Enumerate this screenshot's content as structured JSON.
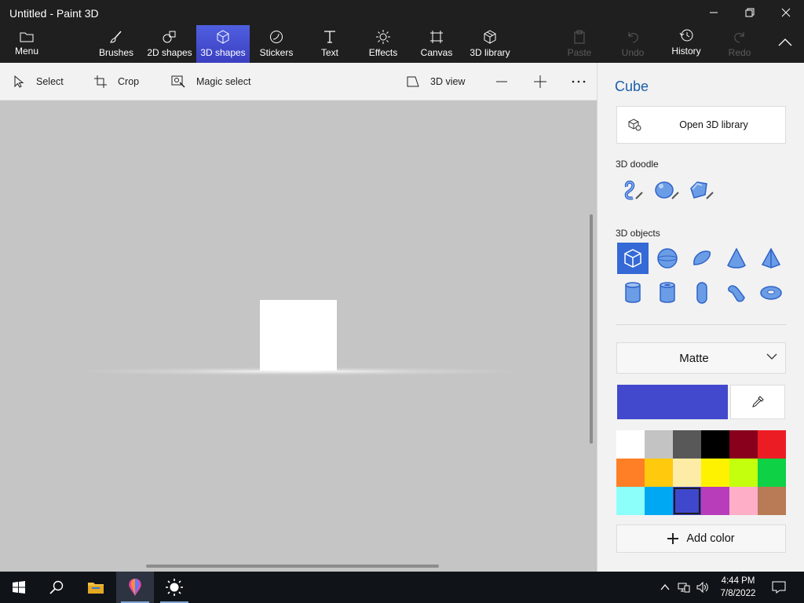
{
  "window": {
    "title": "Untitled - Paint 3D"
  },
  "ribbon": {
    "menu": "Menu",
    "tabs": [
      "Brushes",
      "2D shapes",
      "3D shapes",
      "Stickers",
      "Text",
      "Effects",
      "Canvas",
      "3D library"
    ],
    "active_tab": "3D shapes",
    "actions": {
      "paste": "Paste",
      "undo": "Undo",
      "history": "History",
      "redo": "Redo"
    }
  },
  "toolbar": {
    "select": "Select",
    "crop": "Crop",
    "magic_select": "Magic select",
    "view_3d": "3D view"
  },
  "panel": {
    "title": "Cube",
    "open_library": "Open 3D library",
    "doodle_label": "3D doodle",
    "objects_label": "3D objects",
    "material": "Matte",
    "add_color": "Add color",
    "current_color": "#4349cc",
    "palette": [
      "#ffffff",
      "#c3c3c3",
      "#585858",
      "#000000",
      "#88001b",
      "#ec1c24",
      "#ff7f27",
      "#ffc90e",
      "#fdeca6",
      "#fff200",
      "#c4ff0e",
      "#0ed145",
      "#8cfffb",
      "#00a8f3",
      "#3f48cc",
      "#b83dba",
      "#ffaec8",
      "#b97a56"
    ],
    "selected_swatch": 14
  },
  "taskbar": {
    "time": "4:44 PM",
    "date": "7/8/2022"
  }
}
